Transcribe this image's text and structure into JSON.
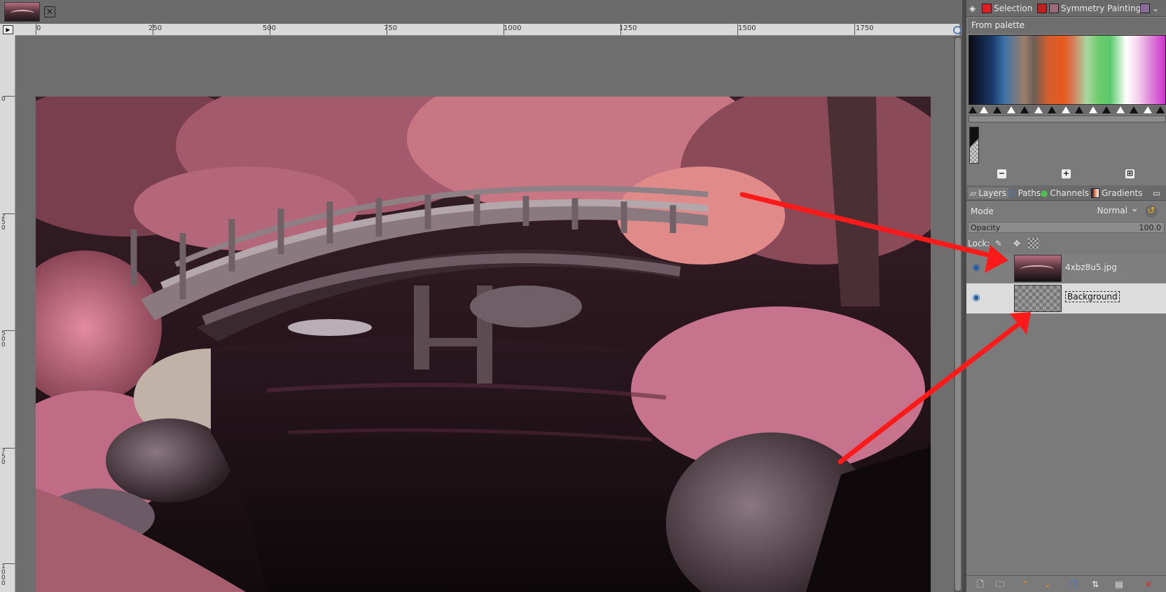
{
  "canvas": {
    "ruler_labels": [
      "0",
      "250",
      "500",
      "750",
      "1000",
      "1250",
      "1500",
      "1750"
    ],
    "vruler_labels": [
      "0",
      "250",
      "500",
      "750",
      "1000"
    ]
  },
  "dock": {
    "top_tabs": [
      "Selection",
      "Symmetry Painting"
    ],
    "palette_select": "From palette",
    "layer_tabs": [
      "Layers",
      "Paths",
      "Channels",
      "Gradients"
    ],
    "mode_label": "Mode",
    "mode_value": "Normal",
    "opacity_label": "Opacity",
    "opacity_value": "100.0",
    "lock_label": "Lock:",
    "layers": [
      {
        "name": "4xbz8u5.jpg",
        "visible": true
      },
      {
        "name": "Background",
        "visible": true
      }
    ]
  },
  "colors": {
    "annotation_arrow": "#ff1a1a",
    "accent_blue": "#1f5da8"
  }
}
